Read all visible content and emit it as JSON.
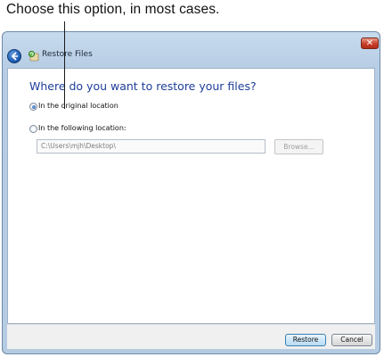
{
  "callout": {
    "text": "Choose this option, in most cases."
  },
  "window": {
    "title": "Restore Files",
    "close_glyph": "✕"
  },
  "main": {
    "heading": "Where do you want to restore your files?",
    "options": [
      {
        "label": "In the original location",
        "checked": true
      },
      {
        "label": "In the following location:",
        "checked": false
      }
    ],
    "path_value": "C:\\Users\\mjh\\Desktop\\",
    "browse_label": "Browse..."
  },
  "footer": {
    "restore_label": "Restore",
    "cancel_label": "Cancel"
  },
  "icons": [
    "back-arrow-icon",
    "restore-files-icon",
    "close-icon"
  ],
  "colors": {
    "heading": "#1e3e99",
    "window_frame": "#b7cde4",
    "close_button": "#c8402b"
  }
}
